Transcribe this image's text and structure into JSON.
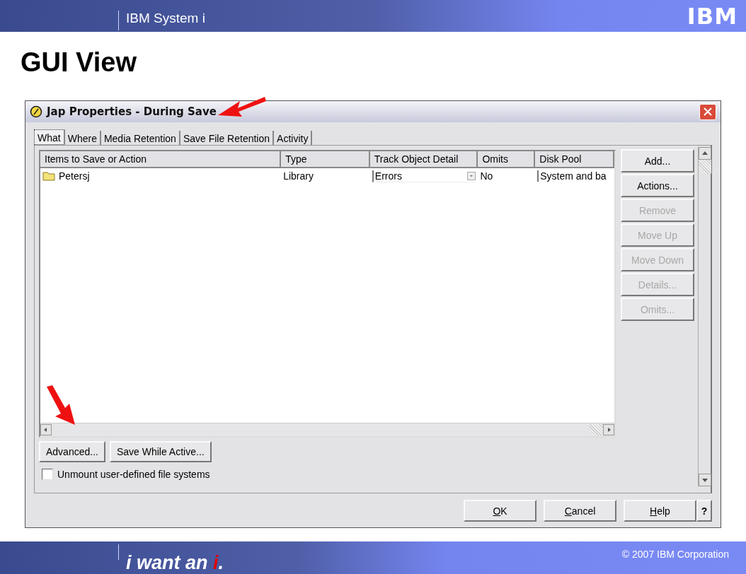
{
  "header": {
    "product": "IBM System i",
    "logo": "IBM"
  },
  "slide_title": "GUI View",
  "dialog": {
    "title": "Jap Properties - During Save",
    "tabs": [
      {
        "label": "What",
        "selected": true
      },
      {
        "label": "Where",
        "selected": false
      },
      {
        "label": "Media Retention",
        "selected": false
      },
      {
        "label": "Save File Retention",
        "selected": false
      },
      {
        "label": "Activity",
        "selected": false
      }
    ],
    "table": {
      "columns": [
        "Items to Save or Action",
        "Type",
        "Track Object Detail",
        "Omits",
        "Disk Pool"
      ],
      "rows": [
        {
          "cells": [
            {
              "text": "Petersj",
              "kind": "folder"
            },
            {
              "text": "Library",
              "kind": "text"
            },
            {
              "text": "Errors",
              "kind": "dropdown"
            },
            {
              "text": "No",
              "kind": "text"
            },
            {
              "text": "System and ba",
              "kind": "text"
            }
          ]
        }
      ]
    },
    "side_buttons": [
      {
        "label": "Add...",
        "disabled": false
      },
      {
        "label": "Actions...",
        "disabled": false
      },
      {
        "label": "Remove",
        "disabled": true
      },
      {
        "label": "Move Up",
        "disabled": true
      },
      {
        "label": "Move Down",
        "disabled": true
      },
      {
        "label": "Details...",
        "disabled": true
      },
      {
        "label": "Omits...",
        "disabled": true
      }
    ],
    "lower_buttons": [
      "Advanced...",
      "Save While Active..."
    ],
    "checkbox": {
      "label": "Unmount user-defined file systems",
      "checked": false
    },
    "footer_buttons": [
      {
        "label": "OK",
        "underline_first": true
      },
      {
        "label": "Cancel",
        "underline_first": true
      },
      {
        "label": "Help",
        "underline_first": true
      },
      {
        "label": "?",
        "underline_first": false
      }
    ]
  },
  "footer": {
    "tagline": [
      {
        "text": "i want an "
      },
      {
        "text": "i",
        "color": "#e00000"
      },
      {
        "text": "."
      }
    ],
    "copyright": "© 2007 IBM Corporation"
  }
}
